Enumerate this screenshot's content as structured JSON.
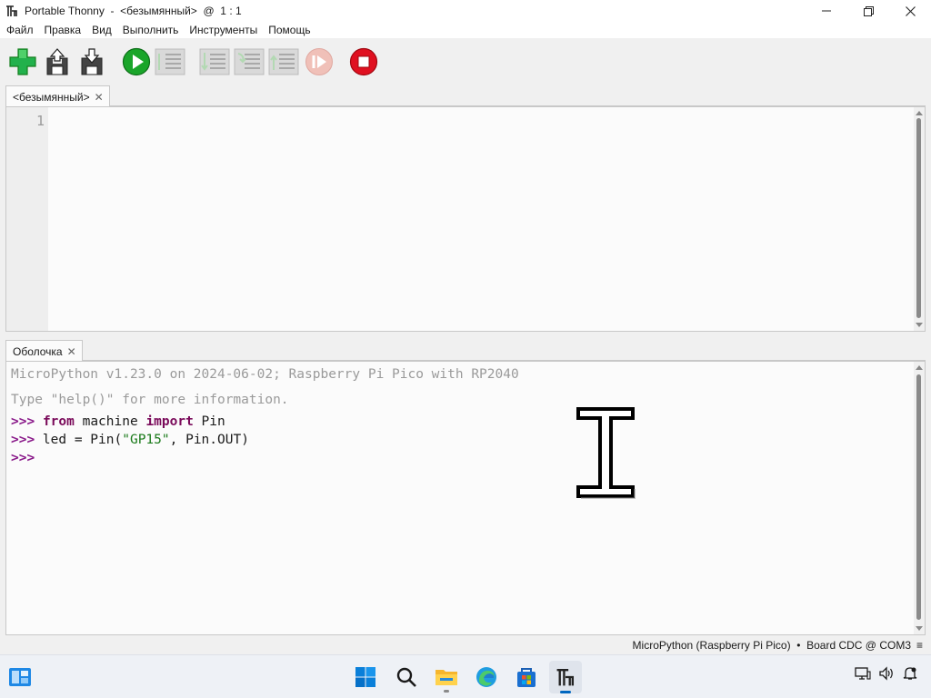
{
  "window": {
    "title": "Portable Thonny  -  <безымянный>  @  1 : 1"
  },
  "menu": {
    "items": [
      "Файл",
      "Правка",
      "Вид",
      "Выполнить",
      "Инструменты",
      "Помощь"
    ]
  },
  "toolbar": {
    "buttons": [
      {
        "name": "new-file",
        "icon": "plus-icon",
        "enabled": true
      },
      {
        "name": "open-file",
        "icon": "open-floppy-icon",
        "enabled": true
      },
      {
        "name": "save-file",
        "icon": "save-floppy-icon",
        "enabled": true
      },
      {
        "name": "run",
        "icon": "play-icon",
        "enabled": true
      },
      {
        "name": "debug",
        "icon": "debug-icon",
        "enabled": false
      },
      {
        "name": "step-over",
        "icon": "step-over-icon",
        "enabled": false
      },
      {
        "name": "step-into",
        "icon": "step-into-icon",
        "enabled": false
      },
      {
        "name": "step-out",
        "icon": "step-out-icon",
        "enabled": false
      },
      {
        "name": "resume",
        "icon": "resume-icon",
        "enabled": false
      },
      {
        "name": "stop",
        "icon": "stop-icon",
        "enabled": true
      }
    ]
  },
  "editor": {
    "tab_label": "<безымянный>",
    "line_numbers": [
      "1"
    ]
  },
  "shell": {
    "tab_label": "Оболочка",
    "banner_1": "MicroPython v1.23.0 on 2024-06-02; Raspberry Pi Pico with RP2040",
    "banner_2": "Type \"help()\" for more information.",
    "prompt": ">>>",
    "line1": {
      "kw1": "from",
      "mid": " machine ",
      "kw2": "import",
      "rest": " Pin"
    },
    "line2": {
      "pre": " led = Pin(",
      "str": "\"GP15\"",
      "post": ", Pin.OUT)"
    }
  },
  "status": {
    "text": "MicroPython (Raspberry Pi Pico)  •  Board CDC @ COM3",
    "menu_glyph": "≡"
  },
  "colors": {
    "accent": "#0067c0",
    "run_green": "#1aa52a",
    "stop_red": "#e01020",
    "prompt_purple": "#8a1a8a",
    "string_green": "#1a7a1a"
  }
}
